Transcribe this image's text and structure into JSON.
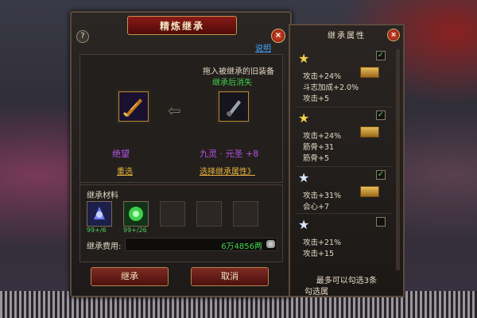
{
  "window": {
    "title": "精炼继承",
    "help_link": "说明"
  },
  "inherit": {
    "drop_hint": "拖入被继承的旧装备",
    "vanish_hint": "继承后消失",
    "left_item_name": "绝望",
    "right_item_name": "九灵 · 元圣 +8",
    "reselect": "重选",
    "select_attr": "选择继承属性》"
  },
  "materials": {
    "title": "继承材料",
    "items": [
      {
        "count": "99+/6"
      },
      {
        "count": "99+/26"
      }
    ],
    "fee_label": "继承费用:",
    "fee_value": "6万4856两"
  },
  "buttons": {
    "inherit": "继承",
    "cancel": "取消"
  },
  "side_panel": {
    "title": "继承属性",
    "attributes": [
      {
        "star": "gold",
        "checked": true,
        "lines": [
          "攻击+24%",
          "斗志加成+2.0%",
          "攻击+5"
        ]
      },
      {
        "star": "gold",
        "checked": true,
        "lines": [
          "攻击+24%",
          "筋骨+31",
          "筋骨+5"
        ]
      },
      {
        "star": "silver",
        "checked": true,
        "lines": [
          "攻击+31%",
          "会心+7",
          ""
        ]
      },
      {
        "star": "silver",
        "checked": false,
        "lines": [
          "攻击+21%",
          "攻击+15",
          ""
        ]
      }
    ],
    "footer": "最多可以勾选3条",
    "footer2": "勾选属"
  },
  "colors": {
    "accent_red": "#7f2a22",
    "gold": "#e8b43a",
    "green": "#3fd04a",
    "purple": "#b452e2"
  }
}
